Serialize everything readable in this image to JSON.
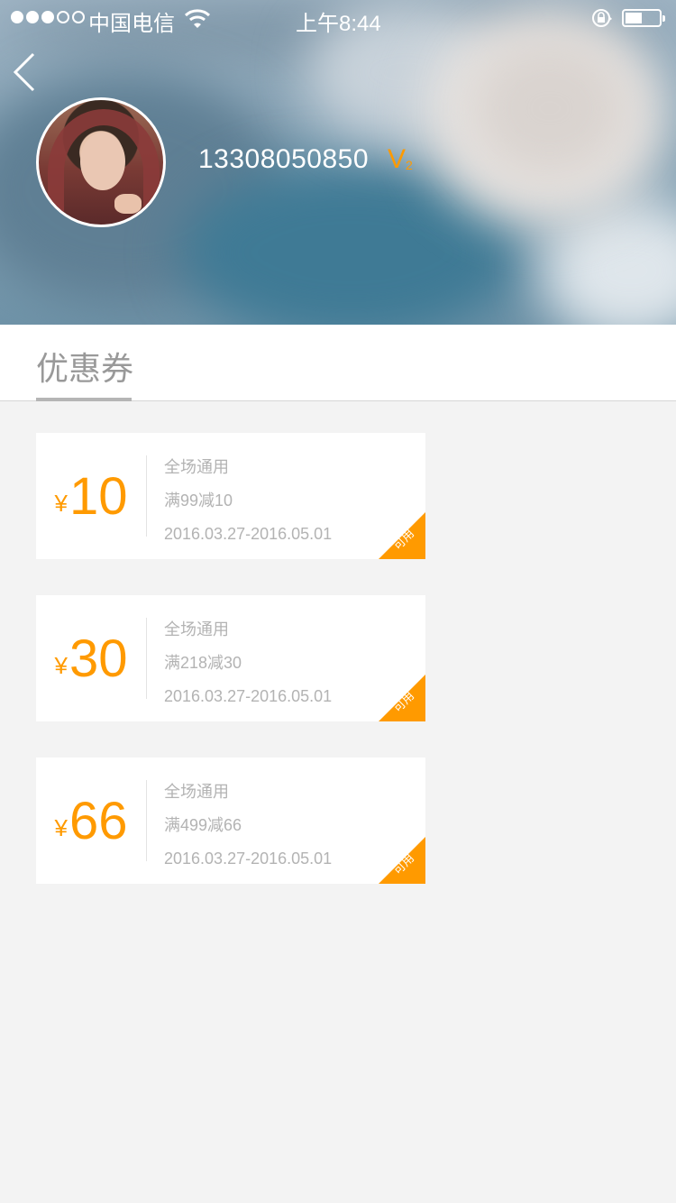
{
  "status_bar": {
    "carrier": "中国电信",
    "time": "上午8:44",
    "signal_bars_filled": 3,
    "signal_bars_total": 5,
    "battery_level": 0.45
  },
  "profile": {
    "phone": "13308050850",
    "vip_letter": "V",
    "vip_level": "2"
  },
  "tabs": [
    {
      "label": "优惠券",
      "active": true
    }
  ],
  "coupons": [
    {
      "currency": "¥",
      "amount": "10",
      "scope": "全场通用",
      "rule": "满99减10",
      "validity": "2016.03.27-2016.05.01",
      "status": "可用"
    },
    {
      "currency": "¥",
      "amount": "30",
      "scope": "全场通用",
      "rule": "满218减30",
      "validity": "2016.03.27-2016.05.01",
      "status": "可用"
    },
    {
      "currency": "¥",
      "amount": "66",
      "scope": "全场通用",
      "rule": "满499减66",
      "validity": "2016.03.27-2016.05.01",
      "status": "可用"
    }
  ],
  "colors": {
    "accent": "#ff9a00",
    "background": "#f3f3f3",
    "muted_text": "#b3b3b3"
  },
  "icons": [
    "back-chevron-icon",
    "wifi-icon",
    "rotation-lock-icon",
    "battery-icon"
  ]
}
